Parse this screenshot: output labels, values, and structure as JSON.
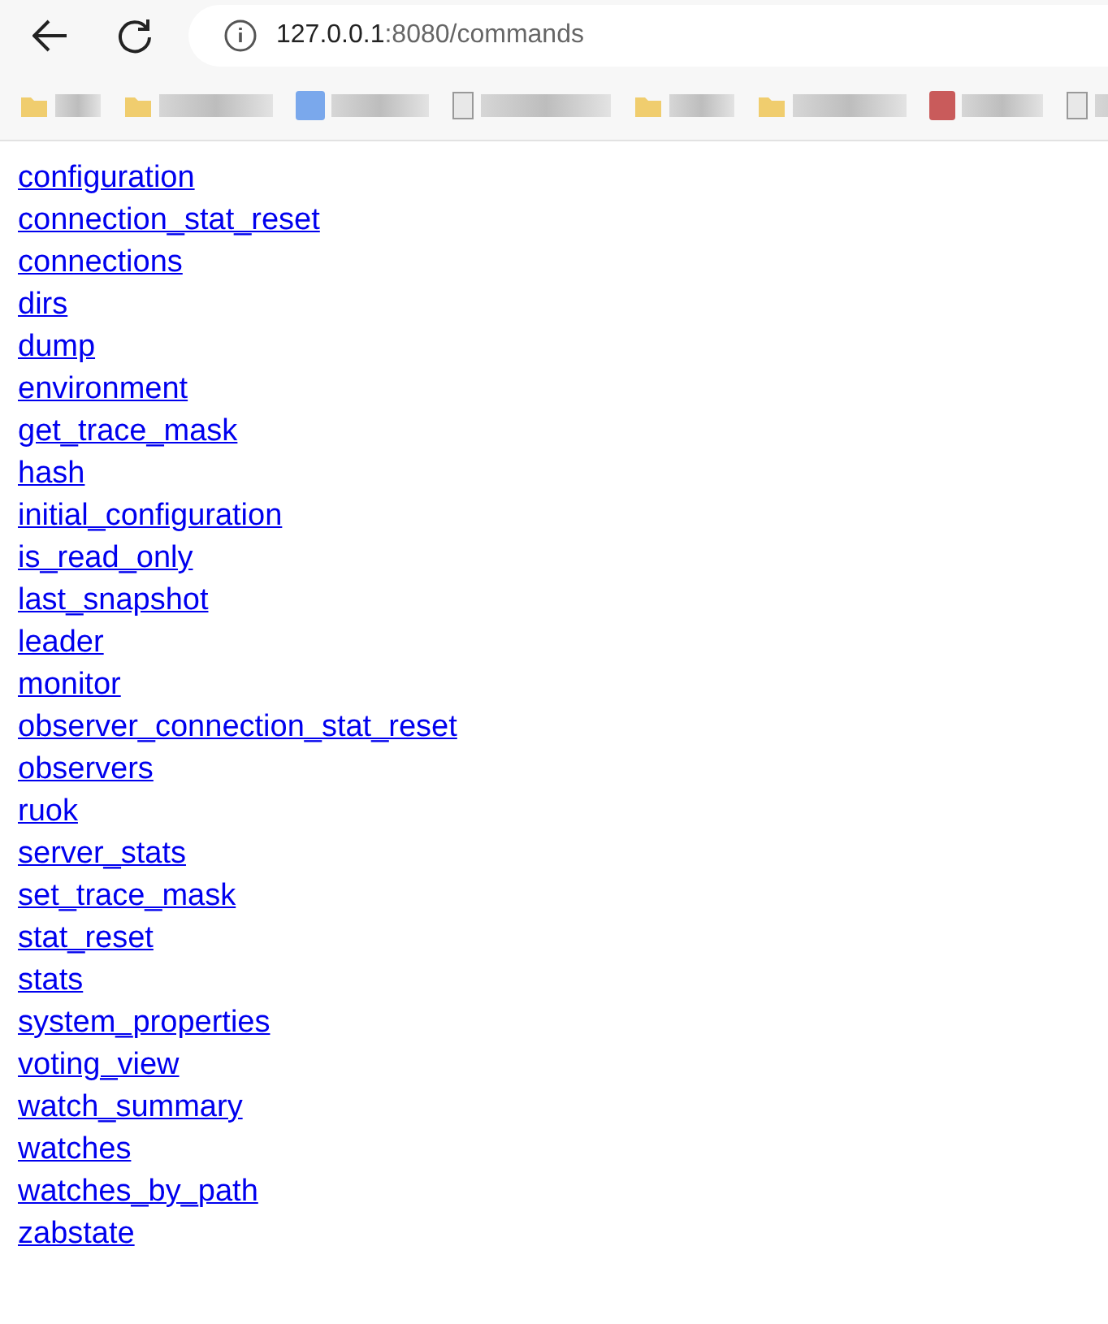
{
  "address_bar": {
    "host": "127.0.0.1",
    "path": ":8080/commands"
  },
  "bookmarks": [
    {
      "kind": "folder"
    },
    {
      "kind": "folder"
    },
    {
      "kind": "blue"
    },
    {
      "kind": "blank"
    },
    {
      "kind": "folder"
    },
    {
      "kind": "folder"
    },
    {
      "kind": "red"
    },
    {
      "kind": "blank"
    }
  ],
  "links": [
    "configuration",
    "connection_stat_reset",
    "connections",
    "dirs",
    "dump",
    "environment",
    "get_trace_mask",
    "hash",
    "initial_configuration",
    "is_read_only",
    "last_snapshot",
    "leader",
    "monitor",
    "observer_connection_stat_reset",
    "observers",
    "ruok",
    "server_stats",
    "set_trace_mask",
    "stat_reset",
    "stats",
    "system_properties",
    "voting_view",
    "watch_summary",
    "watches",
    "watches_by_path",
    "zabstate"
  ]
}
